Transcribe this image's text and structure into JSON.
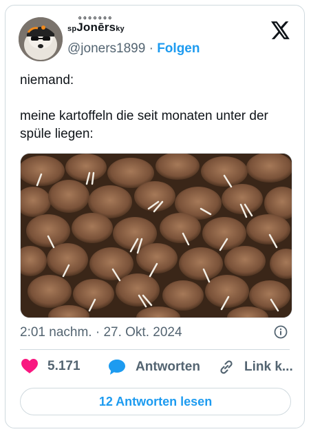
{
  "author": {
    "display_name_prefix": "sp",
    "display_name_main": "Jonērs",
    "display_name_suffix": "ky",
    "display_name_dots": "ooooooo",
    "handle": "@joners1899",
    "separator": "·",
    "follow_label": "Folgen"
  },
  "tweet": {
    "line1": "niemand:",
    "line2": "meine kartoffeln die seit monaten unter der spüle liegen:"
  },
  "meta": {
    "timestamp": "2:01 nachm. · 27. Okt. 2024"
  },
  "actions": {
    "like_count": "5.171",
    "reply_label": "Antworten",
    "link_label": "Link k..."
  },
  "read_replies_label": "12 Antworten lesen",
  "colors": {
    "accent": "#1d9bf0",
    "like": "#f91880",
    "muted": "#536471"
  },
  "icons": [
    "x-logo-icon",
    "info-icon",
    "heart-icon",
    "reply-bubble-icon",
    "link-icon"
  ]
}
